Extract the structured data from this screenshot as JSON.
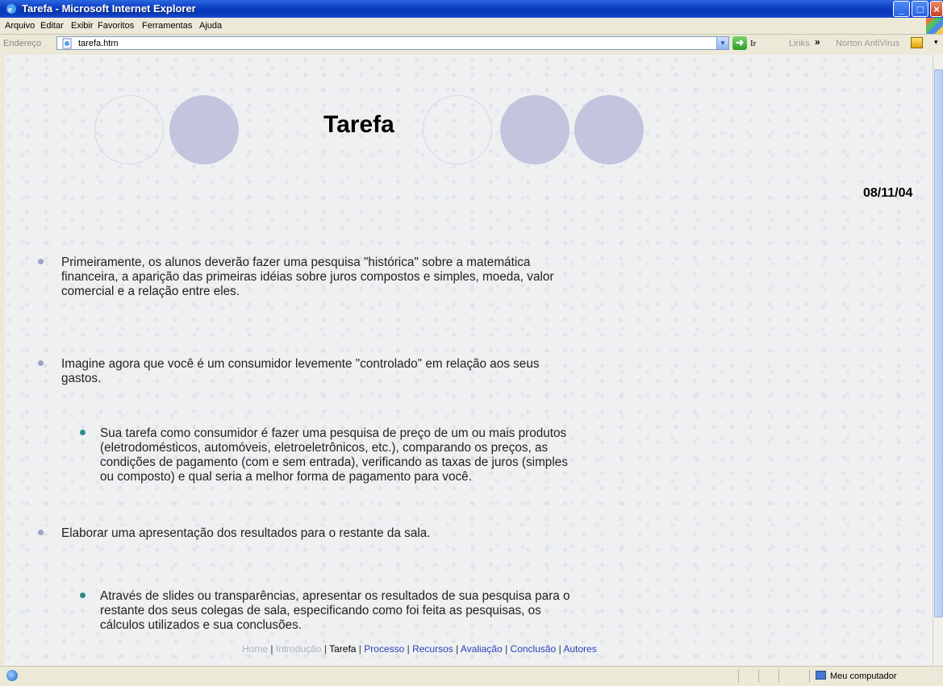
{
  "window": {
    "title": "Tarefa - Microsoft Internet Explorer"
  },
  "menu": [
    "Arquivo",
    "Editar",
    "Exibir",
    "Favoritos",
    "Ferramentas",
    "Ajuda"
  ],
  "address": {
    "label": "Endereço",
    "url": "tarefa.htm",
    "go_label": "Ir",
    "links_label": "Links",
    "links_chevron": "»",
    "norton_label": "Norton AntiVirus"
  },
  "page": {
    "title": "Tarefa",
    "date": "08/11/04",
    "paragraphs": [
      {
        "level": 1,
        "lines": [
          "Primeiramente, os alunos deverão fazer uma pesquisa \"histórica\" sobre a matemática",
          "financeira, a aparição das primeiras idéias sobre juros compostos e simples, moeda, valor",
          "comercial e a relação entre eles."
        ]
      },
      {
        "level": 1,
        "lines": [
          "Imagine agora que você é um consumidor levemente \"controlado\" em relação aos seus",
          "gastos."
        ]
      },
      {
        "level": 2,
        "lines": [
          "Sua tarefa como consumidor é fazer uma pesquisa de preço de um ou mais produtos",
          "(eletrodomésticos, automóveis, eletroeletrônicos, etc.), comparando os preços, as",
          "condições de pagamento (com e sem entrada), verificando as taxas de juros (simples",
          "ou composto) e qual seria a melhor forma de pagamento para você."
        ]
      },
      {
        "level": 1,
        "lines": [
          "Elaborar uma apresentação dos resultados para o restante da sala."
        ]
      },
      {
        "level": 2,
        "lines": [
          "Através de slides ou transparências, apresentar os resultados de sua pesquisa para o",
          "restante dos seus colegas de sala, especificando como foi feita as pesquisas, os",
          "cálculos utilizados e sua conclusões."
        ]
      }
    ],
    "nav": {
      "home": "Home",
      "intro": "Introdução",
      "task": "Tarefa",
      "process": "Processo",
      "resources": "Recursos",
      "evaluation": "Avaliação",
      "conclusion": "Conclusão",
      "authors": "Autores",
      "separator": " | "
    }
  },
  "status": {
    "zone": "Meu computador"
  },
  "colors": {
    "titlebar": "#0a3cc2",
    "circle": "#c2c5dd",
    "link": "#2c3fb6"
  }
}
